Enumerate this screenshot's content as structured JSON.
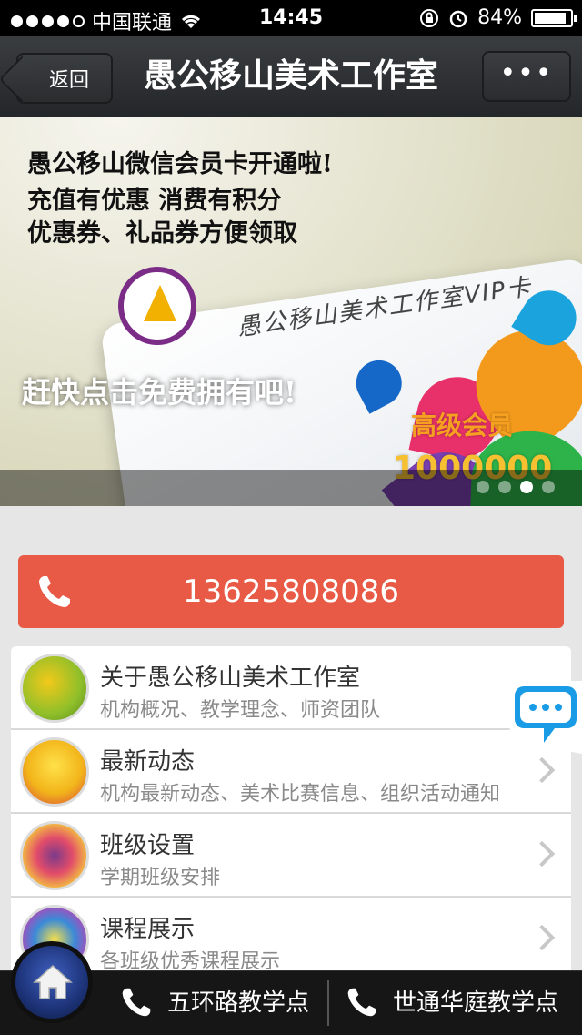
{
  "status_bar": {
    "carrier": "中国联通",
    "time": "14:45",
    "battery": "84%"
  },
  "nav": {
    "back_label": "返回",
    "title": "愚公移山美术工作室",
    "more_label": "•••"
  },
  "banner": {
    "line1": "愚公移山微信会员卡开通啦!",
    "line2": "充值有优惠    消费有积分",
    "line3": "优惠券、礼品券方便领取",
    "card_title": "愚公移山美术工作室VIP卡",
    "cta": "赶快点击免费拥有吧!",
    "level": "高级会员",
    "number": "1000000",
    "pager_total": 4,
    "pager_active": 3
  },
  "phone": {
    "number": "13625808086"
  },
  "list": [
    {
      "title": "关于愚公移山美术工作室",
      "subtitle": "机构概况、教学理念、师资团队"
    },
    {
      "title": "最新动态",
      "subtitle": "机构最新动态、美术比赛信息、组织活动通知"
    },
    {
      "title": "班级设置",
      "subtitle": "学期班级安排"
    },
    {
      "title": "课程展示",
      "subtitle": "各班级优秀课程展示"
    }
  ],
  "bottom_bar": {
    "item1": "五环路教学点",
    "item2": "世通华庭教学点"
  },
  "colors": {
    "accent": "#e85a46",
    "nav_bg": "#2c2f32",
    "bottom_bg": "#161616"
  }
}
